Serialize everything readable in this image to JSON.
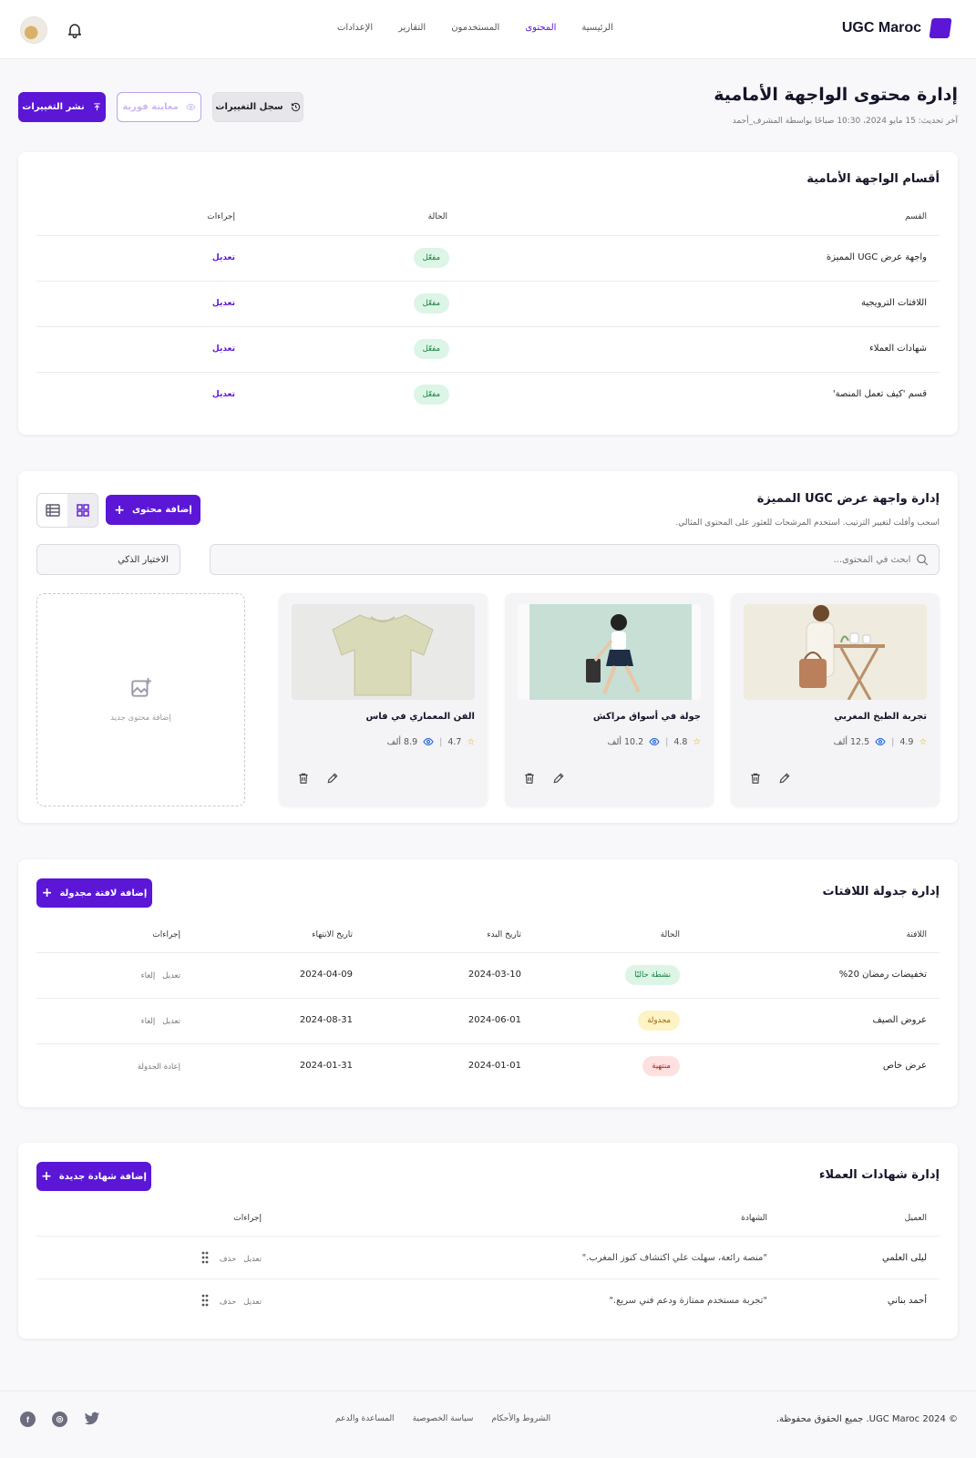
{
  "header": {
    "brand": "UGC Maroc",
    "nav": [
      {
        "label": "الرئيسية",
        "active": false
      },
      {
        "label": "المحتوى",
        "active": true
      },
      {
        "label": "المستخدمون",
        "active": false
      },
      {
        "label": "التقارير",
        "active": false
      },
      {
        "label": "الإعدادات",
        "active": false
      }
    ]
  },
  "page": {
    "title": "إدارة محتوى الواجهة الأمامية",
    "subtitle": "آخر تحديث: 15 مايو 2024، 10:30 صباحًا بواسطة المشرف_أحمد",
    "actions": {
      "publish": "نشر التغييرات",
      "preview": "معاينة فورية",
      "history": "سجل التغييرات"
    }
  },
  "sections": {
    "title": "أقسام الواجهة الأمامية",
    "columns": [
      "القسم",
      "الحالة",
      "إجراءات"
    ],
    "rows": [
      {
        "name": "واجهة عرض UGC المميزة",
        "status": "مفعّل",
        "action": "تعديل"
      },
      {
        "name": "اللافتات الترويجية",
        "status": "مفعّل",
        "action": "تعديل"
      },
      {
        "name": "شهادات العملاء",
        "status": "مفعّل",
        "action": "تعديل"
      },
      {
        "name": "قسم 'كيف تعمل المنصة'",
        "status": "مفعّل",
        "action": "تعديل"
      }
    ]
  },
  "showcase": {
    "title": "إدارة واجهة عرض UGC المميزة",
    "subtitle": "اسحب وأفلت لتغيير الترتيب. استخدم المرشحات للعثور على المحتوى المثالي.",
    "add_button": "إضافة محتوى",
    "search_placeholder": "ابحث في المحتوى...",
    "filter": "الاختيار الذكي",
    "items": [
      {
        "title": "تجربة الطبخ المغربي",
        "rating": "4.9",
        "views": "12.5 ألف"
      },
      {
        "title": "جولة في أسواق مراكش",
        "rating": "4.8",
        "views": "10.2 ألف"
      },
      {
        "title": "الفن المعماري في فاس",
        "rating": "4.7",
        "views": "8.9 ألف"
      }
    ],
    "add_tile": "إضافة محتوى جديد"
  },
  "banners": {
    "title": "إدارة جدولة اللافتات",
    "add_button": "إضافة لافتة مجدولة",
    "columns": [
      "اللافتة",
      "الحالة",
      "تاريخ البدء",
      "تاريخ الانتهاء",
      "إجراءات"
    ],
    "rows": [
      {
        "name": "تخفيضات رمضان 20%",
        "status": "نشطة حاليًا",
        "status_kind": "green",
        "start": "2024-03-10",
        "end": "2024-04-09",
        "a1": "تعديل",
        "a2": "إلغاء"
      },
      {
        "name": "عروض الصيف",
        "status": "مجدولة",
        "status_kind": "yellow",
        "start": "2024-06-01",
        "end": "2024-08-31",
        "a1": "تعديل",
        "a2": "إلغاء"
      },
      {
        "name": "عرض خاص",
        "status": "منتهية",
        "status_kind": "red",
        "start": "2024-01-01",
        "end": "2024-01-31",
        "a1": "إعادة الجدولة",
        "a2": ""
      }
    ]
  },
  "testimonials": {
    "title": "إدارة شهادات العملاء",
    "add_button": "إضافة شهادة جديدة",
    "columns": [
      "العميل",
      "الشهادة",
      "إجراءات"
    ],
    "rows": [
      {
        "client": "ليلى العلمي",
        "quote": "\"منصة رائعة، سهلت علي اكتشاف كنوز المغرب.\"",
        "a1": "تعديل",
        "a2": "حذف"
      },
      {
        "client": "أحمد بناني",
        "quote": "\"تجربة مستخدم ممتازة ودعم فني سريع.\"",
        "a1": "تعديل",
        "a2": "حذف"
      }
    ]
  },
  "footer": {
    "copyright": "© 2024 UGC Maroc. جميع الحقوق محفوظة.",
    "links": [
      "الشروط والأحكام",
      "سياسة الخصوصية",
      "المساعدة والدعم"
    ]
  },
  "colors": {
    "accent": "#5b16d6",
    "active_green": "#15803d",
    "scheduled_yellow": "#a16207",
    "ended_red": "#b91c1c"
  }
}
